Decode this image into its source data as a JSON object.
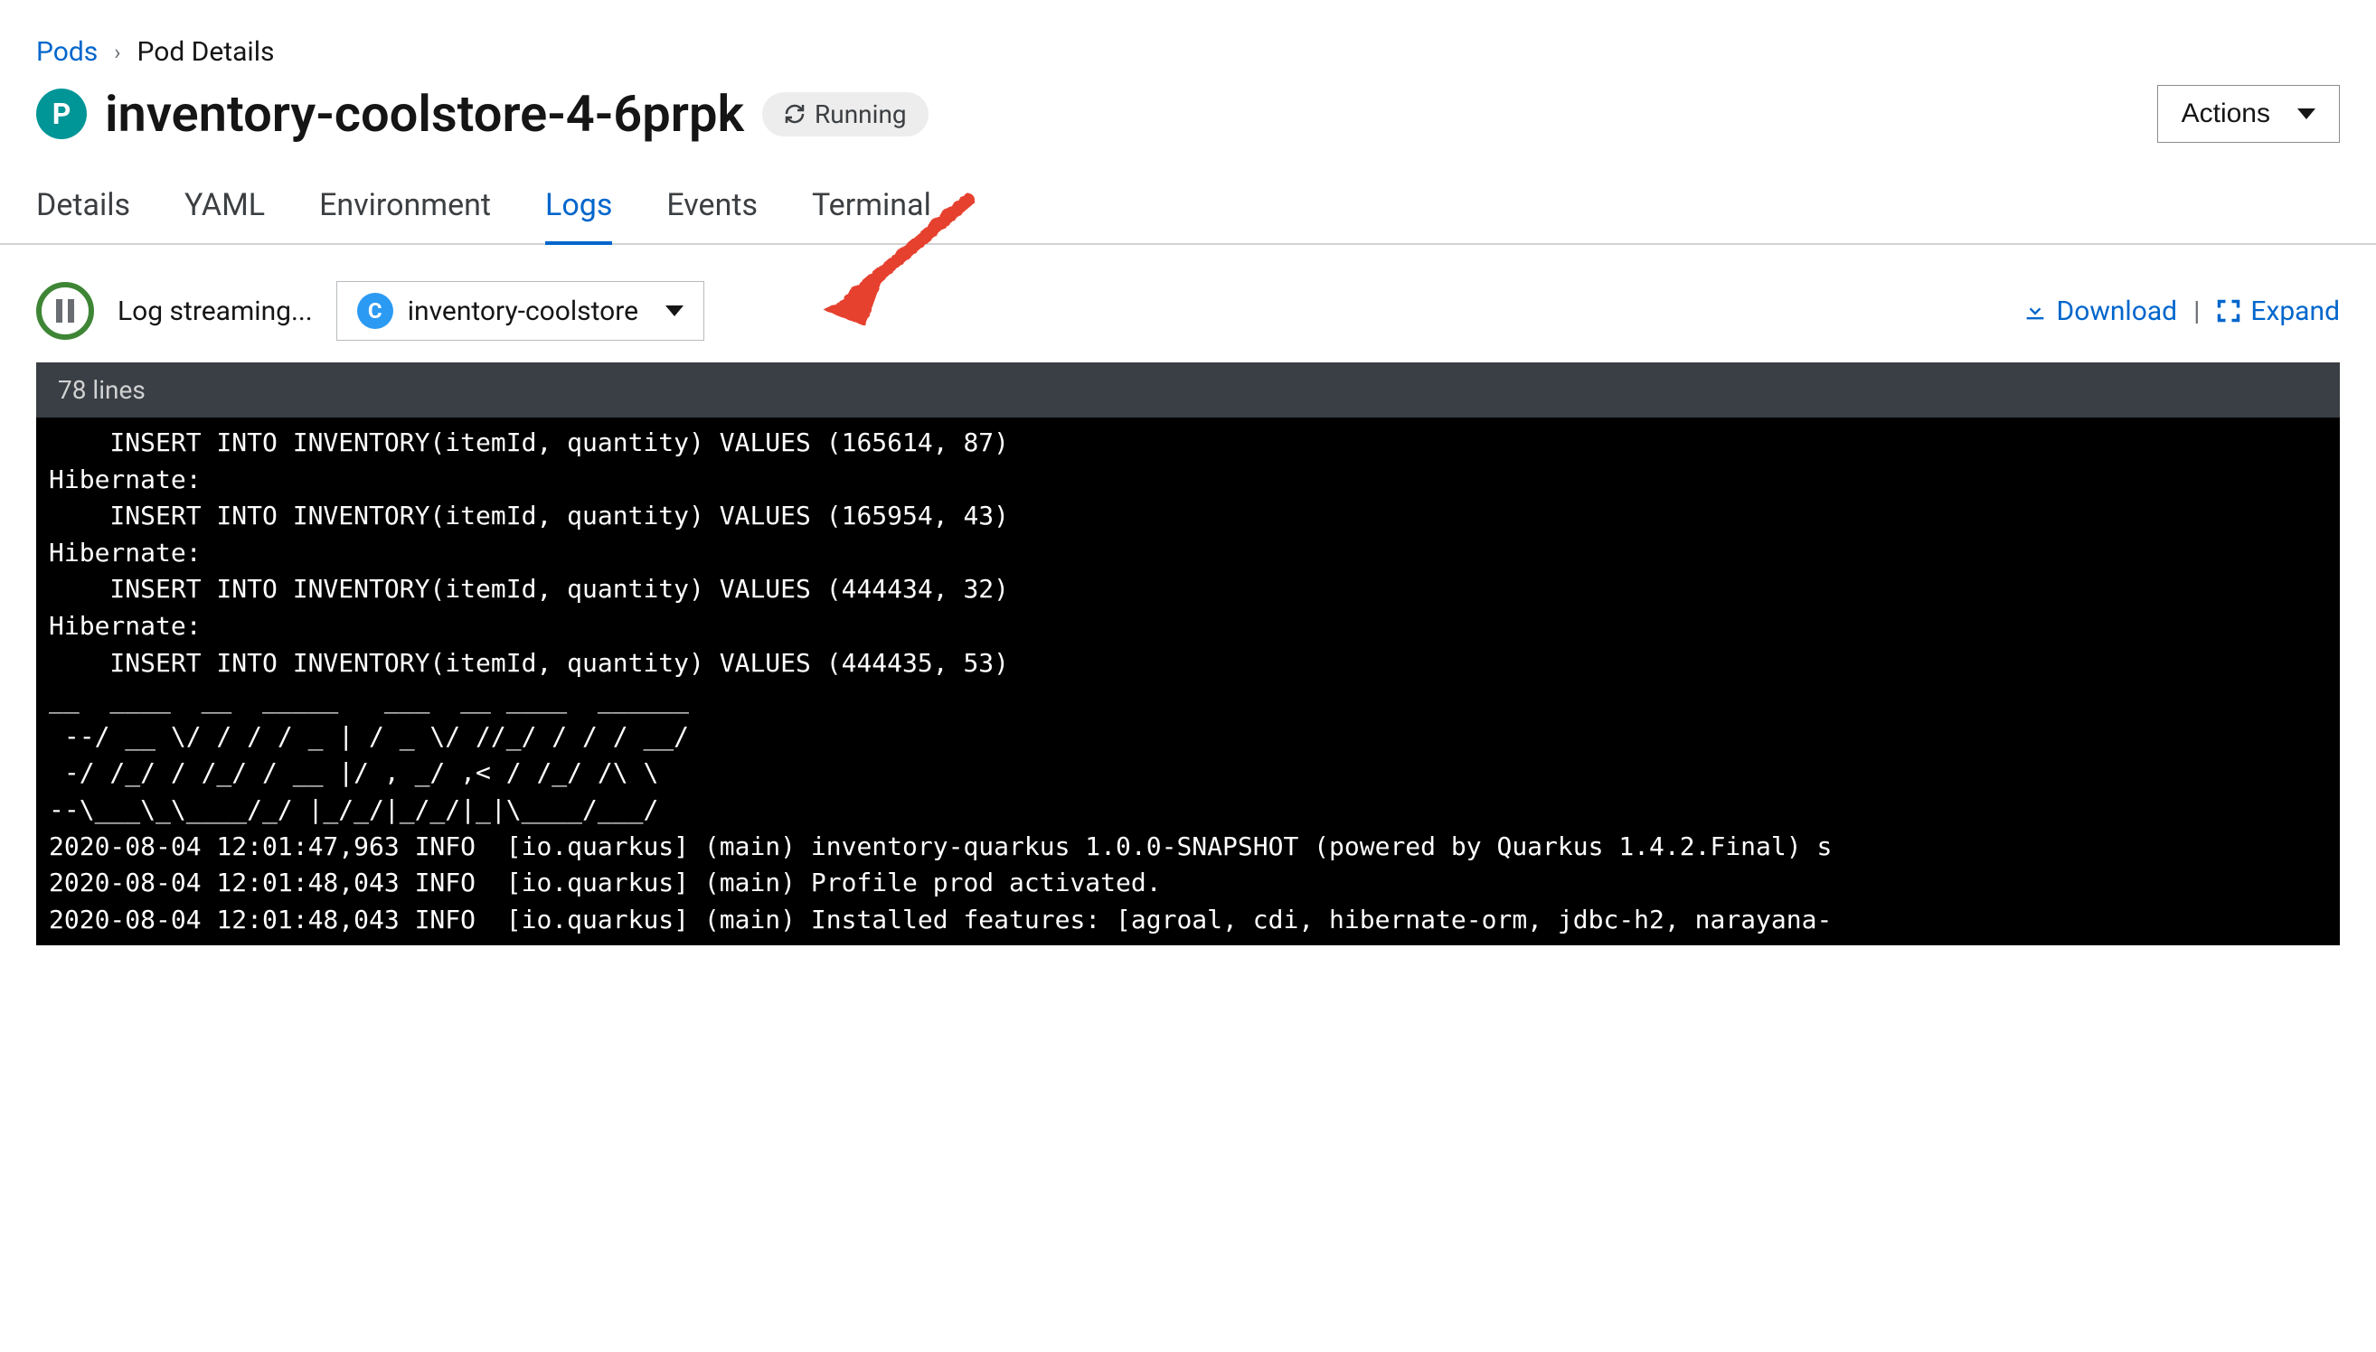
{
  "breadcrumb": {
    "root": "Pods",
    "current": "Pod Details"
  },
  "pod": {
    "badge_letter": "P",
    "name": "inventory-coolstore-4-6prpk",
    "status": "Running"
  },
  "actions_label": "Actions",
  "tabs": {
    "details": "Details",
    "yaml": "YAML",
    "environment": "Environment",
    "logs": "Logs",
    "events": "Events",
    "terminal": "Terminal"
  },
  "log_toolbar": {
    "streaming_label": "Log streaming...",
    "container_badge": "C",
    "container_name": "inventory-coolstore",
    "download": "Download",
    "expand": "Expand"
  },
  "log": {
    "line_count": "78 lines",
    "lines": [
      "    INSERT INTO INVENTORY(itemId, quantity) VALUES (165614, 87)",
      "Hibernate:",
      "    INSERT INTO INVENTORY(itemId, quantity) VALUES (165954, 43)",
      "Hibernate:",
      "    INSERT INTO INVENTORY(itemId, quantity) VALUES (444434, 32)",
      "Hibernate:",
      "    INSERT INTO INVENTORY(itemId, quantity) VALUES (444435, 53)",
      "__  ____  __  _____   ___  __ ____  ______",
      " --/ __ \\/ / / / _ | / _ \\/ //_/ / / / __/",
      " -/ /_/ / /_/ / __ |/ , _/ ,< / /_/ /\\ \\",
      "--\\___\\_\\____/_/ |_/_/|_/_/|_|\\____/___/",
      "2020-08-04 12:01:47,963 INFO  [io.quarkus] (main) inventory-quarkus 1.0.0-SNAPSHOT (powered by Quarkus 1.4.2.Final) s",
      "2020-08-04 12:01:48,043 INFO  [io.quarkus] (main) Profile prod activated.",
      "2020-08-04 12:01:48,043 INFO  [io.quarkus] (main) Installed features: [agroal, cdi, hibernate-orm, jdbc-h2, narayana-"
    ]
  }
}
